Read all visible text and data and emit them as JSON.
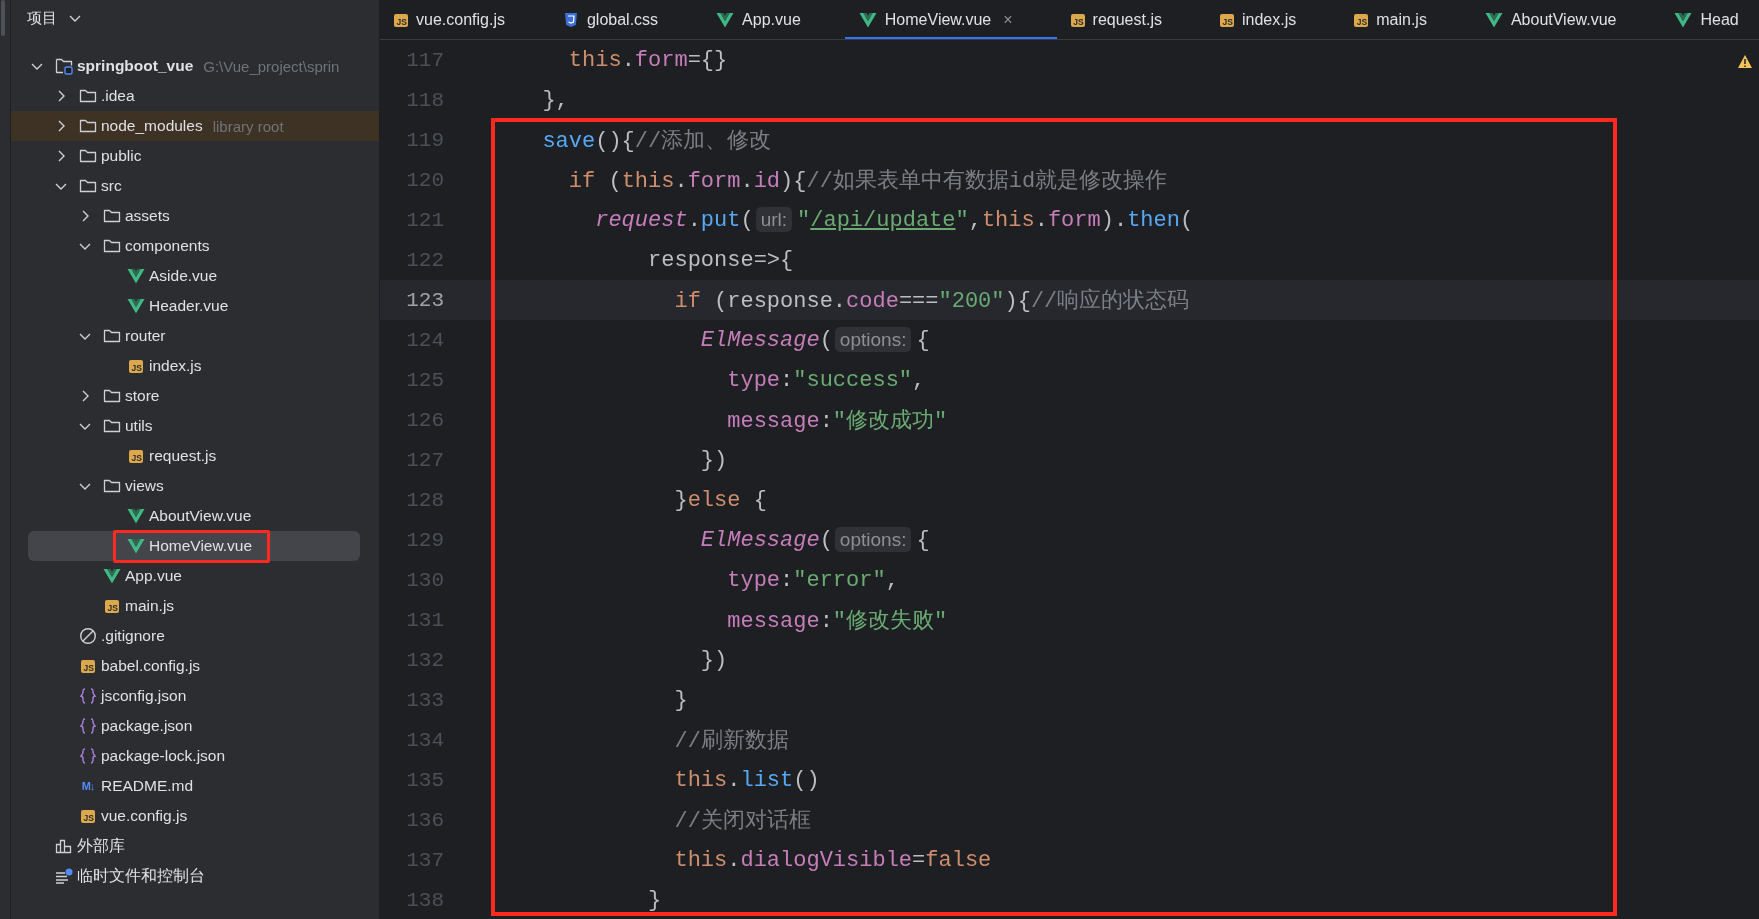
{
  "sidebar": {
    "title": "项目",
    "tree": [
      {
        "kind": "module",
        "label": "springboot_vue",
        "hint": "G:\\Vue_project\\sprin",
        "expanded": true,
        "selected": false,
        "excluded": false,
        "annotated": false,
        "children": [
          {
            "kind": "folder",
            "label": ".idea",
            "expanded": false,
            "selected": false,
            "excluded": false,
            "annotated": false
          },
          {
            "kind": "folder",
            "label": "node_modules",
            "hint": "library root",
            "expanded": false,
            "selected": false,
            "excluded": true,
            "annotated": false
          },
          {
            "kind": "folder",
            "label": "public",
            "expanded": false,
            "selected": false,
            "excluded": false,
            "annotated": false
          },
          {
            "kind": "folder",
            "label": "src",
            "expanded": true,
            "selected": false,
            "excluded": false,
            "annotated": false,
            "children": [
              {
                "kind": "folder",
                "label": "assets",
                "expanded": false,
                "selected": false,
                "excluded": false,
                "annotated": false
              },
              {
                "kind": "folder",
                "label": "components",
                "expanded": true,
                "selected": false,
                "excluded": false,
                "annotated": false,
                "children": [
                  {
                    "kind": "vue",
                    "label": "Aside.vue",
                    "selected": false,
                    "excluded": false,
                    "annotated": false
                  },
                  {
                    "kind": "vue",
                    "label": "Header.vue",
                    "selected": false,
                    "excluded": false,
                    "annotated": false
                  }
                ]
              },
              {
                "kind": "folder",
                "label": "router",
                "expanded": true,
                "selected": false,
                "excluded": false,
                "annotated": false,
                "children": [
                  {
                    "kind": "js",
                    "badge": "JS",
                    "label": "index.js",
                    "selected": false,
                    "excluded": false,
                    "annotated": false
                  }
                ]
              },
              {
                "kind": "folder",
                "label": "store",
                "expanded": false,
                "selected": false,
                "excluded": false,
                "annotated": false
              },
              {
                "kind": "folder",
                "label": "utils",
                "expanded": true,
                "selected": false,
                "excluded": false,
                "annotated": false,
                "children": [
                  {
                    "kind": "js",
                    "badge": "JS",
                    "label": "request.js",
                    "selected": false,
                    "excluded": false,
                    "annotated": false
                  }
                ]
              },
              {
                "kind": "folder",
                "label": "views",
                "expanded": true,
                "selected": false,
                "excluded": false,
                "annotated": false,
                "children": [
                  {
                    "kind": "vue",
                    "label": "AboutView.vue",
                    "selected": false,
                    "excluded": false,
                    "annotated": false
                  },
                  {
                    "kind": "vue",
                    "label": "HomeView.vue",
                    "selected": true,
                    "excluded": false,
                    "annotated": true
                  }
                ]
              },
              {
                "kind": "vue",
                "label": "App.vue",
                "selected": false,
                "excluded": false,
                "annotated": false
              },
              {
                "kind": "js",
                "badge": "JS",
                "label": "main.js",
                "selected": false,
                "excluded": false,
                "annotated": false
              }
            ]
          },
          {
            "kind": "gitignore",
            "label": ".gitignore",
            "selected": false,
            "excluded": false,
            "annotated": false
          },
          {
            "kind": "js",
            "badge": "JS",
            "label": "babel.config.js",
            "selected": false,
            "excluded": false,
            "annotated": false
          },
          {
            "kind": "json",
            "label": "jsconfig.json",
            "selected": false,
            "excluded": false,
            "annotated": false
          },
          {
            "kind": "json",
            "label": "package.json",
            "selected": false,
            "excluded": false,
            "annotated": false
          },
          {
            "kind": "json",
            "label": "package-lock.json",
            "selected": false,
            "excluded": false,
            "annotated": false
          },
          {
            "kind": "md",
            "badge": "M↓",
            "label": "README.md",
            "selected": false,
            "excluded": false,
            "annotated": false
          },
          {
            "kind": "js",
            "badge": "JS",
            "label": "vue.config.js",
            "selected": false,
            "excluded": false,
            "annotated": false
          }
        ]
      },
      {
        "kind": "library",
        "label": "外部库",
        "selected": false,
        "excluded": false,
        "annotated": false
      },
      {
        "kind": "scratches",
        "label": "临时文件和控制台",
        "selected": false,
        "excluded": false,
        "annotated": false
      }
    ]
  },
  "tabs": [
    {
      "kind": "js",
      "badge": "JS",
      "label": "vue.config.js",
      "selected": false
    },
    {
      "kind": "css",
      "label": "global.css",
      "selected": false
    },
    {
      "kind": "vue",
      "label": "App.vue",
      "selected": false
    },
    {
      "kind": "vue",
      "label": "HomeView.vue",
      "selected": true,
      "close": "×"
    },
    {
      "kind": "js",
      "badge": "JS",
      "label": "request.js",
      "selected": false
    },
    {
      "kind": "js",
      "badge": "JS",
      "label": "index.js",
      "selected": false
    },
    {
      "kind": "js",
      "badge": "JS",
      "label": "main.js",
      "selected": false
    },
    {
      "kind": "vue",
      "label": "AboutView.vue",
      "selected": false
    },
    {
      "kind": "vue",
      "label": "Head",
      "selected": false
    }
  ],
  "editor": {
    "warning": true,
    "groups": [
      {
        "boxed": false,
        "lines": [
          {
            "number": "117",
            "current": false,
            "tokens": [
              {
                "kind": "kw",
                "text": "    this"
              },
              {
                "kind": "pl",
                "text": "."
              },
              {
                "kind": "prop",
                "text": "form"
              },
              {
                "kind": "pl",
                "text": "={}"
              }
            ]
          },
          {
            "number": "118",
            "current": false,
            "tokens": [
              {
                "kind": "pl",
                "text": "  },"
              }
            ]
          }
        ]
      },
      {
        "boxed": true,
        "lines": [
          {
            "number": "119",
            "current": false,
            "tokens": [
              {
                "kind": "fn",
                "text": "  save"
              },
              {
                "kind": "pl",
                "text": "(){"
              },
              {
                "kind": "com",
                "text": "//添加、修改"
              }
            ]
          },
          {
            "number": "120",
            "current": false,
            "tokens": [
              {
                "kind": "kw",
                "text": "    if"
              },
              {
                "kind": "pl",
                "text": " ("
              },
              {
                "kind": "kw",
                "text": "this"
              },
              {
                "kind": "pl",
                "text": "."
              },
              {
                "kind": "prop",
                "text": "form"
              },
              {
                "kind": "pl",
                "text": "."
              },
              {
                "kind": "prop",
                "text": "id"
              },
              {
                "kind": "pl",
                "text": "){"
              },
              {
                "kind": "com",
                "text": "//如果表单中有数据id就是修改操作"
              }
            ]
          },
          {
            "number": "121",
            "current": false,
            "tokens": [
              {
                "kind": "ifn",
                "text": "      request"
              },
              {
                "kind": "pl",
                "text": "."
              },
              {
                "kind": "fn",
                "text": "put"
              },
              {
                "kind": "pl",
                "text": "("
              },
              {
                "kind": "hint",
                "text": "url:"
              },
              {
                "kind": "str",
                "text": "\""
              },
              {
                "kind": "url",
                "text": "/api/update"
              },
              {
                "kind": "str",
                "text": "\""
              },
              {
                "kind": "pl",
                "text": ","
              },
              {
                "kind": "kw",
                "text": "this"
              },
              {
                "kind": "pl",
                "text": "."
              },
              {
                "kind": "prop",
                "text": "form"
              },
              {
                "kind": "pl",
                "text": ")."
              },
              {
                "kind": "fn",
                "text": "then"
              },
              {
                "kind": "pl",
                "text": "("
              }
            ]
          },
          {
            "number": "122",
            "current": false,
            "tokens": [
              {
                "kind": "pl",
                "text": "          response=>{"
              }
            ]
          },
          {
            "number": "123",
            "current": true,
            "tokens": [
              {
                "kind": "kw",
                "text": "            if"
              },
              {
                "kind": "pl",
                "text": " (response."
              },
              {
                "kind": "prop",
                "text": "code"
              },
              {
                "kind": "pl",
                "text": "==="
              },
              {
                "kind": "str",
                "text": "\"200\""
              },
              {
                "kind": "pl",
                "text": "){"
              },
              {
                "kind": "com",
                "text": "//响应的状态码"
              }
            ]
          },
          {
            "number": "124",
            "current": false,
            "tokens": [
              {
                "kind": "ifn",
                "text": "              ElMessage"
              },
              {
                "kind": "pl",
                "text": "("
              },
              {
                "kind": "hint",
                "text": "options:"
              },
              {
                "kind": "pl",
                "text": "{"
              }
            ]
          },
          {
            "number": "125",
            "current": false,
            "tokens": [
              {
                "kind": "prop",
                "text": "                type"
              },
              {
                "kind": "pl",
                "text": ":"
              },
              {
                "kind": "str",
                "text": "\"success\""
              },
              {
                "kind": "pl",
                "text": ","
              }
            ]
          },
          {
            "number": "126",
            "current": false,
            "tokens": [
              {
                "kind": "prop",
                "text": "                message"
              },
              {
                "kind": "pl",
                "text": ":"
              },
              {
                "kind": "str",
                "text": "\"修改成功\""
              }
            ]
          },
          {
            "number": "127",
            "current": false,
            "tokens": [
              {
                "kind": "pl",
                "text": "              })"
              }
            ]
          },
          {
            "number": "128",
            "current": false,
            "tokens": [
              {
                "kind": "pl",
                "text": "            }"
              },
              {
                "kind": "kw",
                "text": "else"
              },
              {
                "kind": "pl",
                "text": " {"
              }
            ]
          },
          {
            "number": "129",
            "current": false,
            "tokens": [
              {
                "kind": "ifn",
                "text": "              ElMessage"
              },
              {
                "kind": "pl",
                "text": "("
              },
              {
                "kind": "hint",
                "text": "options:"
              },
              {
                "kind": "pl",
                "text": "{"
              }
            ]
          },
          {
            "number": "130",
            "current": false,
            "tokens": [
              {
                "kind": "prop",
                "text": "                type"
              },
              {
                "kind": "pl",
                "text": ":"
              },
              {
                "kind": "str",
                "text": "\"error\""
              },
              {
                "kind": "pl",
                "text": ","
              }
            ]
          },
          {
            "number": "131",
            "current": false,
            "tokens": [
              {
                "kind": "prop",
                "text": "                message"
              },
              {
                "kind": "pl",
                "text": ":"
              },
              {
                "kind": "str",
                "text": "\"修改失败\""
              }
            ]
          },
          {
            "number": "132",
            "current": false,
            "tokens": [
              {
                "kind": "pl",
                "text": "              })"
              }
            ]
          },
          {
            "number": "133",
            "current": false,
            "tokens": [
              {
                "kind": "pl",
                "text": "            }"
              }
            ]
          },
          {
            "number": "134",
            "current": false,
            "tokens": [
              {
                "kind": "com",
                "text": "            //刷新数据"
              }
            ]
          },
          {
            "number": "135",
            "current": false,
            "tokens": [
              {
                "kind": "kw",
                "text": "            this"
              },
              {
                "kind": "pl",
                "text": "."
              },
              {
                "kind": "fn",
                "text": "list"
              },
              {
                "kind": "pl",
                "text": "()"
              }
            ]
          },
          {
            "number": "136",
            "current": false,
            "tokens": [
              {
                "kind": "com",
                "text": "            //关闭对话框"
              }
            ]
          },
          {
            "number": "137",
            "current": false,
            "tokens": [
              {
                "kind": "kw",
                "text": "            this"
              },
              {
                "kind": "pl",
                "text": "."
              },
              {
                "kind": "prop",
                "text": "dialogVisible"
              },
              {
                "kind": "pl",
                "text": "="
              },
              {
                "kind": "kw",
                "text": "false"
              }
            ]
          },
          {
            "number": "138",
            "current": false,
            "tokens": [
              {
                "kind": "pl",
                "text": "          }"
              }
            ]
          }
        ]
      }
    ]
  }
}
